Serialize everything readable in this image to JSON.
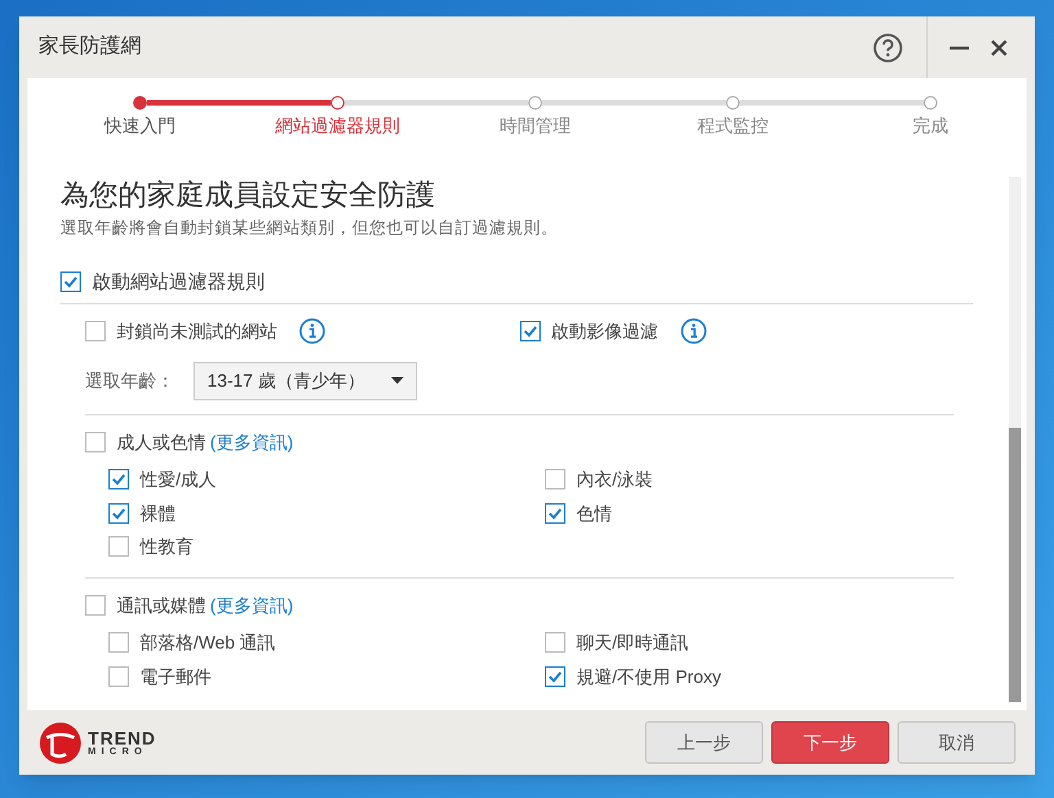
{
  "window": {
    "title": "家長防護網"
  },
  "logo": {
    "line_1": "TREND",
    "line_2": "MICRO"
  },
  "steps": [
    {
      "label": "快速入門",
      "completed": true,
      "selected": false
    },
    {
      "label": "網站過濾器規則",
      "completed": false,
      "selected": true
    },
    {
      "label": "時間管理",
      "completed": false,
      "selected": false
    },
    {
      "label": "程式監控",
      "completed": false,
      "selected": false
    },
    {
      "label": "完成",
      "completed": false,
      "selected": false
    }
  ],
  "heading": "為您的家庭成員設定安全防護",
  "subheading": "選取年齡將會自動封鎖某些網站類別，但您也可以自訂過濾規則。",
  "enable_filter": {
    "label": "啟動網站過濾器規則",
    "checked": true
  },
  "options": [
    {
      "label": "封鎖尚未測試的網站",
      "checked": false
    },
    {
      "label": "啟動影像過濾",
      "checked": true
    }
  ],
  "age": {
    "label": "選取年齡：",
    "value": "13-17 歲（青少年）"
  },
  "categories": [
    {
      "label": "成人或色情",
      "link": "(更多資訊)",
      "checked": false,
      "items": [
        {
          "label": "性愛/成人",
          "checked": true
        },
        {
          "label": "內衣/泳裝",
          "checked": false
        },
        {
          "label": "裸體",
          "checked": true
        },
        {
          "label": "色情",
          "checked": true
        },
        {
          "label": "性教育",
          "checked": false
        }
      ]
    },
    {
      "label": "通訊或媒體",
      "link": "(更多資訊)",
      "checked": false,
      "items": [
        {
          "label": "部落格/Web 通訊",
          "checked": false
        },
        {
          "label": "聊天/即時通訊",
          "checked": false
        },
        {
          "label": "電子郵件",
          "checked": false
        },
        {
          "label": "規避/不使用 Proxy",
          "checked": true
        }
      ]
    }
  ],
  "footer": {
    "buttons": [
      {
        "label": "上一步",
        "kind": "secondary"
      },
      {
        "label": "下一步",
        "kind": "primary"
      },
      {
        "label": "取消",
        "kind": "secondary"
      }
    ]
  }
}
